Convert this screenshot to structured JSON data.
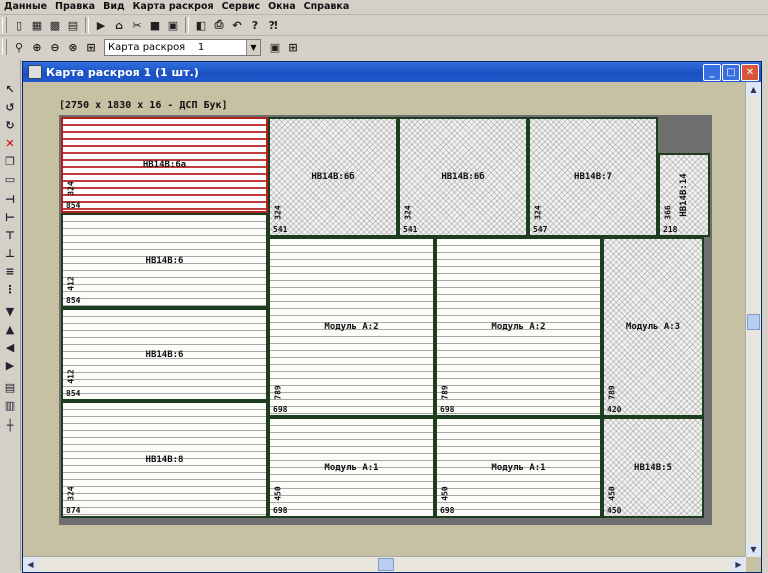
{
  "menu": [
    "Данные",
    "Правка",
    "Вид",
    "Карта раскроя",
    "Сервис",
    "Окна",
    "Справка"
  ],
  "toolbar_icons": [
    "new-icon",
    "table-icon",
    "grid-icon",
    "layers-icon",
    "play-icon",
    "open-icon",
    "cut-icon",
    "save-icon",
    "save-all-icon",
    "preview-icon",
    "print-icon",
    "undo-icon",
    "help-icon",
    "context-help-icon"
  ],
  "view_toolbar_icons": [
    "zoom-icon",
    "zoom-in-icon",
    "zoom-out-icon",
    "zoom-fit-icon",
    "zoom-select-icon"
  ],
  "combo": {
    "value": "Карта раскроя    1"
  },
  "window": {
    "title": "Карта раскроя 1 (1 шт.)"
  },
  "sheet": {
    "header": "[2750 x 1830 x 16 - ДСП Бук]"
  },
  "parts": [
    {
      "name": "НВ14В:6а",
      "width": "854",
      "height": "324",
      "style": "selected"
    },
    {
      "name": "НВ14В:6б",
      "width": "541",
      "height": "324",
      "style": "crosshatch"
    },
    {
      "name": "НВ14В:6б",
      "width": "541",
      "height": "324",
      "style": "crosshatch"
    },
    {
      "name": "НВ14В:7",
      "width": "547",
      "height": "324",
      "style": "crosshatch"
    },
    {
      "name": "НВ14В:14",
      "width": "218",
      "height": "366",
      "style": "crosshatch"
    },
    {
      "name": "НВ14В:6",
      "width": "854",
      "height": "412",
      "style": "lines"
    },
    {
      "name": "НВ14В:6",
      "width": "854",
      "height": "412",
      "style": "lines"
    },
    {
      "name": "Модуль А:2",
      "width": "698",
      "height": "789",
      "style": "lines"
    },
    {
      "name": "Модуль А:2",
      "width": "698",
      "height": "789",
      "style": "lines"
    },
    {
      "name": "Модуль А:3",
      "width": "420",
      "height": "789",
      "style": "crosshatch"
    },
    {
      "name": "НВ14В:8",
      "width": "874",
      "height": "324",
      "style": "lines"
    },
    {
      "name": "Модуль А:1",
      "width": "698",
      "height": "450",
      "style": "lines"
    },
    {
      "name": "Модуль А:1",
      "width": "698",
      "height": "450",
      "style": "lines"
    },
    {
      "name": "НВ14В:5",
      "width": "450",
      "height": "450",
      "style": "crosshatch"
    }
  ]
}
